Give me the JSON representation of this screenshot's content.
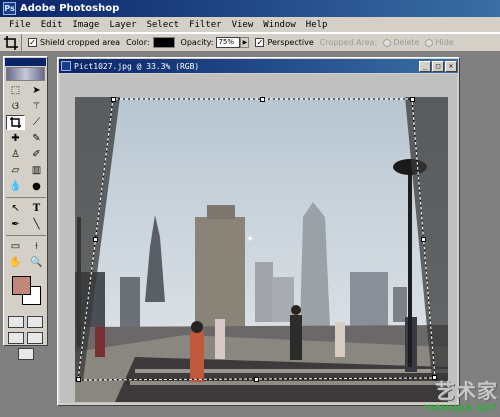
{
  "app": {
    "title": "Adobe Photoshop"
  },
  "menu": [
    "File",
    "Edit",
    "Image",
    "Layer",
    "Select",
    "Filter",
    "View",
    "Window",
    "Help"
  ],
  "options": {
    "shield_label": "Shield cropped area",
    "shield_checked": true,
    "color_label": "Color:",
    "color_value": "#000000",
    "opacity_label": "Opacity:",
    "opacity_value": "75%",
    "perspective_label": "Perspective",
    "perspective_checked": true,
    "cropped_area_label": "Cropped Area:",
    "delete_label": "Delete",
    "hide_label": "Hide"
  },
  "toolbox": {
    "tools": [
      "rectangular-marquee",
      "move",
      "lasso",
      "magic-wand",
      "crop",
      "slice",
      "healing-brush",
      "brush",
      "clone-stamp",
      "history-brush",
      "eraser",
      "gradient",
      "blur",
      "dodge",
      "path-selection",
      "type",
      "pen",
      "line",
      "notes",
      "eyedropper",
      "hand",
      "zoom"
    ],
    "foreground_color": "#c08878",
    "background_color": "#ffffff"
  },
  "document": {
    "title": "Pict1027.jpg @ 33.3% (RGB)",
    "zoom": "33.3%",
    "mode": "RGB"
  },
  "watermark": {
    "big": "艺术家",
    "small": "YISHUJIA.NET"
  }
}
